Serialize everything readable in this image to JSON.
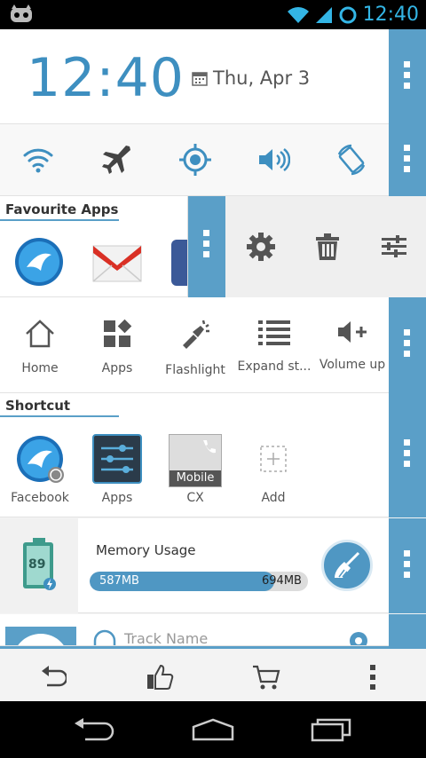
{
  "status_bar": {
    "time": "12:40"
  },
  "clock": {
    "time": "12:40",
    "date": "Thu, Apr 3"
  },
  "toggles": [
    "wifi-icon",
    "airplane-icon",
    "gps-icon",
    "volume-icon",
    "rotate-icon"
  ],
  "favourite_apps": {
    "title": "Favourite Apps",
    "apps": [
      "Boat Browser",
      "Gmail",
      "Facebook"
    ]
  },
  "popup_actions": [
    "gear-icon",
    "trash-icon",
    "sliders-icon"
  ],
  "actions": [
    {
      "label": "Home",
      "icon": "home-icon"
    },
    {
      "label": "Apps",
      "icon": "apps-icon"
    },
    {
      "label": "Flashlight",
      "icon": "flashlight-icon"
    },
    {
      "label": "Expand st...",
      "icon": "list-icon"
    },
    {
      "label": "Volume up",
      "icon": "volume-up-icon"
    }
  ],
  "shortcut": {
    "title": "Shortcut",
    "items": [
      {
        "label": "Facebook"
      },
      {
        "label": "Apps"
      },
      {
        "label": "CX",
        "badge": "Mobile"
      },
      {
        "label": "Add"
      }
    ]
  },
  "memory": {
    "battery": "89",
    "title": "Memory Usage",
    "used": "587MB",
    "total": "694MB",
    "fraction": 0.846
  },
  "music": {
    "track": "Track Name"
  },
  "colors": {
    "accent": "#5a9fc8",
    "clock": "#3e8fc0",
    "status": "#33b5e5"
  }
}
